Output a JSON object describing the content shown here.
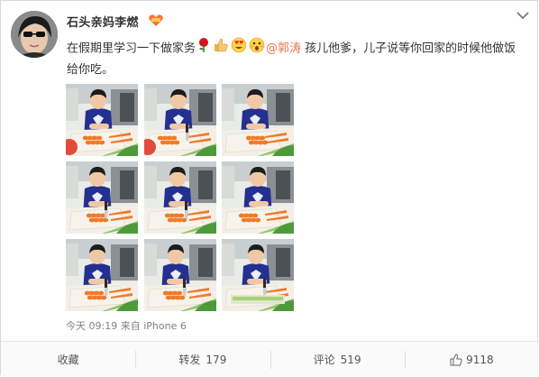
{
  "user": {
    "name": "石头亲妈李燃"
  },
  "post": {
    "text_before": "在假期里学习一下做家务",
    "mention": "@郭涛",
    "text_after": " 孩儿他爹，儿子说等你回家的时候他做饭给你吃。",
    "emojis": [
      "rose-icon",
      "thumbs-up-icon",
      "heart-eyes-icon",
      "surprised-icon"
    ]
  },
  "meta": {
    "time": "今天 09:19",
    "source_prefix": "来自",
    "source": "iPhone 6"
  },
  "actions": {
    "favorite": {
      "label": "收藏"
    },
    "repost": {
      "label": "转发",
      "count": "179"
    },
    "comment": {
      "label": "评论",
      "count": "519"
    },
    "like": {
      "count": "9118"
    }
  },
  "colors": {
    "mention": "#eb7350",
    "text": "#333333",
    "meta": "#808080"
  }
}
